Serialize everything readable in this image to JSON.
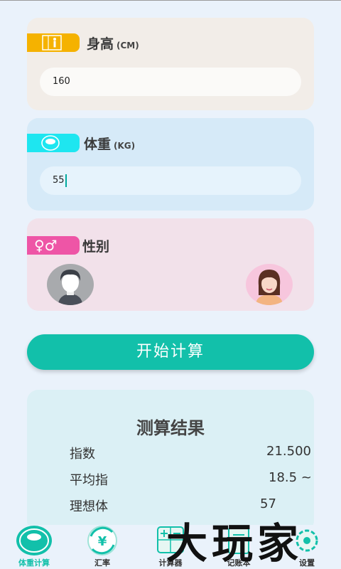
{
  "height_card": {
    "title": "身高",
    "unit": "(CM)",
    "value": "160"
  },
  "weight_card": {
    "title": "体重",
    "unit": "(KG)",
    "value": "55"
  },
  "gender_card": {
    "title": "性别",
    "tag_symbol": "♀♂"
  },
  "calculate_button": "开始计算",
  "result": {
    "title": "测算结果",
    "rows": [
      {
        "label": "指数",
        "value": "21.500"
      },
      {
        "label": "平均指",
        "value": "18.5 ~"
      },
      {
        "label": "理想体",
        "value": "57"
      }
    ]
  },
  "tabs": [
    {
      "label": "体重计算",
      "icon": "scale-icon",
      "active": true
    },
    {
      "label": "汇率",
      "icon": "yen-exchange-icon",
      "active": false
    },
    {
      "label": "计算器",
      "icon": "calculator-icon",
      "active": false
    },
    {
      "label": "记账本",
      "icon": "notebook-icon",
      "active": false
    },
    {
      "label": "设置",
      "icon": "settings-icon",
      "active": false
    }
  ],
  "watermark": "大玩家",
  "colors": {
    "accent": "#12c0aa",
    "height_tag": "#f5b200",
    "weight_tag": "#1ee6f0",
    "gender_tag": "#ee55a6"
  }
}
